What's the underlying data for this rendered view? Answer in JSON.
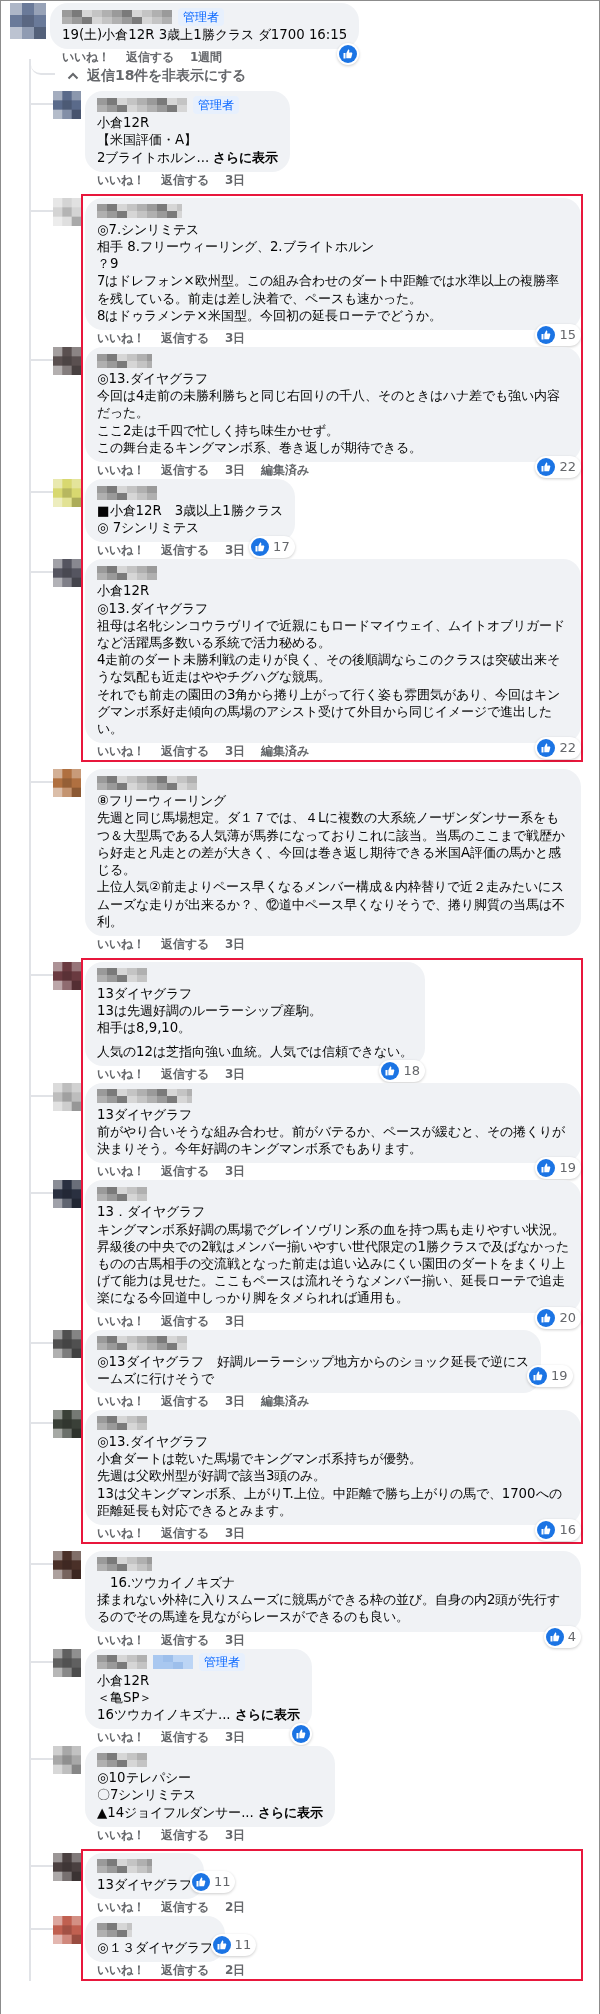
{
  "root": {
    "color": "#6a7a99",
    "admin_label": "管理者",
    "paragraphs": [
      [
        "19(土)小倉12R 3歳上1勝クラス ダ1700 16:15"
      ]
    ],
    "reaction": true,
    "like": "いいね！",
    "reply": "返信する",
    "time": "1週間"
  },
  "replies_toggle": "返信18件を非表示にする",
  "reply_groups": [
    {
      "highlighted": false,
      "replies": [
        {
          "color": "#5a6a8a",
          "admin_label": "管理者",
          "paragraphs": [
            [
              "小倉12R",
              "【米国評価・A】",
              "2ブライトホルン..."
            ]
          ],
          "see_more": "さらに表示",
          "reaction": false,
          "like": "いいね！",
          "reply": "返信する",
          "time": "3日"
        }
      ]
    },
    {
      "highlighted": true,
      "replies": [
        {
          "color": "#d4d4d4",
          "paragraphs": [
            [
              "◎7.シンリミテス",
              "相手 8.フリーウィーリング、2.ブライトホルン",
              "？9",
              "7はドレフォン×欧州型。この組み合わせのダート中距離では水準以上の複勝率を残している。前走は差し決着で、ペースも速かった。",
              "8はドゥラメンテ×米国型。今回初の延長ローテでどうか。"
            ]
          ],
          "reaction": true,
          "reaction_count": "15",
          "like": "いいね！",
          "reply": "返信する",
          "time": "3日"
        },
        {
          "color": "#5a5050",
          "paragraphs": [
            [
              "◎13.ダイヤグラフ",
              "今回は4走前の未勝利勝ちと同じ右回りの千八、そのときはハナ差でも強い内容だった。",
              "ここ2走は千四で忙しく持ち味生かせず。",
              "この舞台走るキングマンボ系、巻き返しが期待できる。"
            ]
          ],
          "reaction": true,
          "reaction_count": "22",
          "like": "いいね！",
          "reply": "返信する",
          "time": "3日",
          "edited": "編集済み"
        },
        {
          "color": "#d8d870",
          "paragraphs": [
            [
              "■小倉12R　3歳以上1勝クラス",
              "◎ 7シンリミテス"
            ]
          ],
          "reaction": true,
          "reaction_count": "17",
          "like": "いいね！",
          "reply": "返信する",
          "time": "3日"
        },
        {
          "color": "#555560",
          "paragraphs": [
            [
              "小倉12R",
              "◎13.ダイヤグラフ",
              "祖母は名牝シンコウラヴリイで近親にもロードマイウェイ、ムイトオブリガードなど活躍馬多数いる系統で活力秘める。",
              "4走前のダート未勝利戦の走りが良く、その後順調ならこのクラスは突破出来そうな気配も近走はややチグハグな競馬。",
              "それでも前走の園田の3角から捲り上がって行く姿も雰囲気があり、今回はキングマンボ系好走傾向の馬場のアシスト受けて外目から同じイメージで進出したい。"
            ]
          ],
          "reaction": true,
          "reaction_count": "22",
          "like": "いいね！",
          "reply": "返信する",
          "time": "3日",
          "edited": "編集済み"
        }
      ]
    },
    {
      "highlighted": false,
      "replies": [
        {
          "color": "#b07040",
          "paragraphs": [
            [
              "⑧フリーウィーリング",
              "先週と同じ馬場想定。ダ１７では、４Lに複数の大系統ノーザンダンサー系をもつ＆大型馬である人気薄が馬券になっておりこれに該当。当馬のここまで戦歴から好走と凡走との差が大きく、今回は巻き返し期待できる米国A評価の馬かと感じる。",
              "上位人気②前走よりペース早くなるメンバー構成＆内枠替りで近２走みたいにスムーズな走りが出来るか？、⑫道中ペース早くなりそうで、捲り脚質の当馬は不利。"
            ]
          ],
          "reaction": false,
          "like": "いいね！",
          "reply": "返信する",
          "time": "3日"
        }
      ]
    },
    {
      "highlighted": true,
      "replies": [
        {
          "color": "#6a3a40",
          "paragraphs": [
            [
              "13ダイヤグラフ",
              "13は先週好調のルーラーシップ産駒。",
              "相手は8,9,10。"
            ],
            [
              "人気の12は芝指向強い血統。人気では信頼できない。"
            ]
          ],
          "reaction": true,
          "reaction_count": "18",
          "like": "いいね！",
          "reply": "返信する",
          "time": "3日"
        },
        {
          "color": "#bdbdbd",
          "paragraphs": [
            [
              "13ダイヤグラフ",
              "前がやり合いそうな組み合わせ。前がバテるか、ペースが緩むと、その捲くりが決まりそう。今年好調のキングマンボ系でもあります。"
            ]
          ],
          "reaction": true,
          "reaction_count": "19",
          "like": "いいね！",
          "reply": "返信する",
          "time": "3日"
        },
        {
          "color": "#2a3040",
          "paragraphs": [
            [
              "13．ダイヤグラフ",
              "キングマンボ系好調の馬場でグレイソヴリン系の血を持つ馬も走りやすい状況。昇級後の中央での2戦はメンバー揃いやすい世代限定の1勝クラスで及ばなかったものの古馬相手の交流戦となった前走は追い込みにくい園田のダートをまくり上げて能力は見せた。ここもペースは流れそうなメンバー揃い、延長ローテで追走楽になる今回道中しっかり脚をタメられれば通用も。"
            ]
          ],
          "reaction": true,
          "reaction_count": "20",
          "like": "いいね！",
          "reply": "返信する",
          "time": "3日"
        },
        {
          "color": "#505050",
          "paragraphs": [
            [
              "◎13ダイヤグラフ　好調ルーラーシップ地方からのショック延長で逆にスームズに行けそうで"
            ]
          ],
          "reaction": true,
          "reaction_count": "19",
          "like": "いいね！",
          "reply": "返信する",
          "time": "3日",
          "edited": "編集済み"
        },
        {
          "color": "#3a4038",
          "paragraphs": [
            [
              "◎13.ダイヤグラフ",
              "小倉ダートは乾いた馬場でキングマンボ系持ちが優勢。",
              "先週は父欧州型が好調で該当3頭のみ。",
              "13は父キングマンボ系、上がりT.上位。中距離で勝ち上がりの馬で、1700への距離延長も対応できるとみます。"
            ]
          ],
          "reaction": true,
          "reaction_count": "16",
          "like": "いいね！",
          "reply": "返信する",
          "time": "3日"
        }
      ]
    },
    {
      "highlighted": false,
      "replies": [
        {
          "color": "#4a3028",
          "paragraphs": [
            [
              "　16.ツウカイノキズナ",
              "揉まれない外枠に入りスムーズに競馬ができる枠の並び。自身の内2頭が先行するのでその馬達を見ながらレースができるのも良い。"
            ]
          ],
          "reaction": true,
          "reaction_count": "4",
          "like": "いいね！",
          "reply": "返信する",
          "time": "3日"
        },
        {
          "color": "#606060",
          "tag_redacted": true,
          "admin_label": "管理者",
          "paragraphs": [
            [
              "小倉12R",
              "＜亀SP＞",
              "16ツウカイノキズナ..."
            ]
          ],
          "see_more": "さらに表示",
          "reaction": true,
          "like": "いいね！",
          "reply": "返信する",
          "time": "3日"
        },
        {
          "color": "#a8a8a8",
          "paragraphs": [
            [
              "◎10テレパシー",
              "〇7シンリミテス",
              "▲14ジョイフルダンサー..."
            ]
          ],
          "see_more": "さらに表示",
          "reaction": false,
          "like": "いいね！",
          "reply": "返信する",
          "time": "3日"
        }
      ]
    },
    {
      "highlighted": true,
      "replies": [
        {
          "color": "#4a4040",
          "paragraphs": [
            [
              "13ダイヤグラフ"
            ]
          ],
          "reaction": true,
          "reaction_count": "11",
          "like": "いいね！",
          "reply": "返信する",
          "time": "2日"
        },
        {
          "color": "#c06050",
          "paragraphs": [
            [
              "◎１３ダイヤグラフ"
            ]
          ],
          "reaction": true,
          "reaction_count": "11",
          "like": "いいね！",
          "reply": "返信する",
          "time": "2日"
        }
      ]
    }
  ]
}
